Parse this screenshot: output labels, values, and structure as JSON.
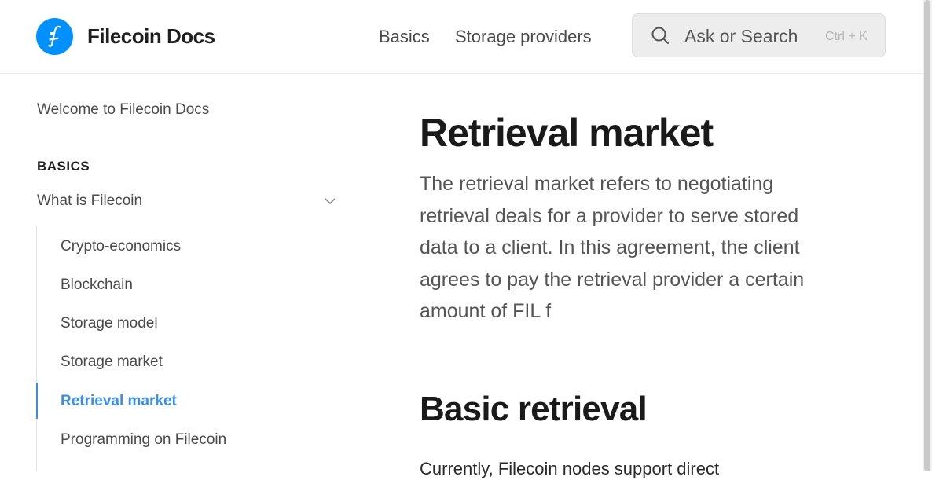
{
  "header": {
    "brand": "Filecoin Docs",
    "nav": [
      {
        "label": "Basics"
      },
      {
        "label": "Storage providers"
      }
    ],
    "search": {
      "placeholder": "Ask or Search",
      "shortcut": "Ctrl + K"
    }
  },
  "sidebar": {
    "welcome": "Welcome to Filecoin Docs",
    "section": "BASICS",
    "group": {
      "label": "What is Filecoin",
      "expanded": true,
      "items": [
        {
          "label": "Crypto-economics"
        },
        {
          "label": "Blockchain"
        },
        {
          "label": "Storage model"
        },
        {
          "label": "Storage market"
        },
        {
          "label": "Retrieval market",
          "active": true
        },
        {
          "label": "Programming on Filecoin"
        }
      ]
    }
  },
  "main": {
    "title": "Retrieval market",
    "description": "The retrieval market refers to negotiating retrieval deals for a provider to serve stored data to a client. In this agreement, the client agrees to pay the retrieval provider a certain amount of FIL f",
    "section_title": "Basic retrieval",
    "body": "Currently, Filecoin nodes support direct"
  },
  "colors": {
    "brand": "#0090ff",
    "accent": "#3b8de8",
    "search_bg": "#ededed"
  },
  "icons": {
    "logo": "filecoin-logo-icon",
    "search": "search-icon",
    "chevron": "chevron-down-icon"
  }
}
